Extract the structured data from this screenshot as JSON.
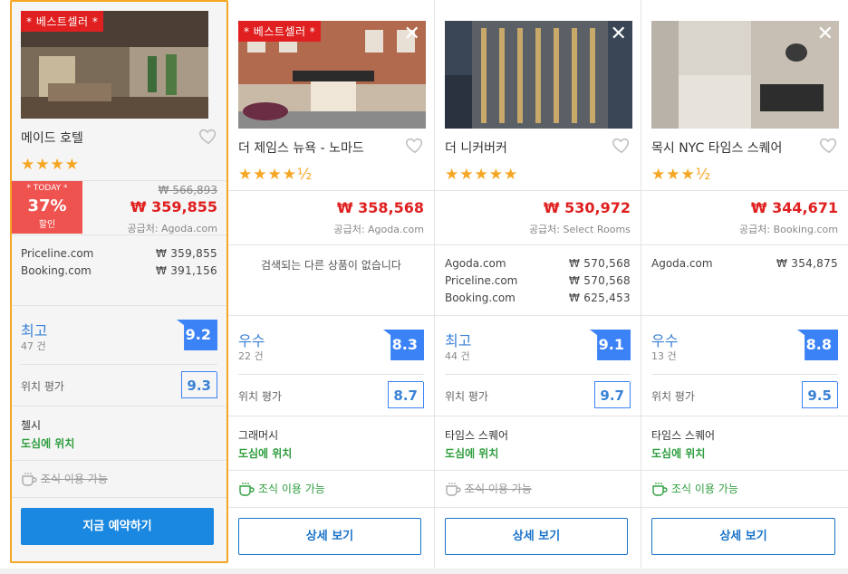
{
  "hotels": [
    {
      "badge": "* 베스트셀러 *",
      "name": "메이드 호텔",
      "stars": "★★★★",
      "today": {
        "label": "* TODAY *",
        "percent": "37%",
        "sub": "할인"
      },
      "old_price": "₩ 566,893",
      "price": "₩ 359,855",
      "supplier": "공급처: Agoda.com",
      "others": [
        {
          "site": "Priceline.com",
          "price": "₩ 359,855"
        },
        {
          "site": "Booking.com",
          "price": "₩ 391,156"
        }
      ],
      "rating_label": "최고",
      "rating_count": "47 건",
      "score": "9.2",
      "location_label": "위치 평가",
      "location_score": "9.3",
      "area": "첼시",
      "area_sub": "도심에 위치",
      "breakfast": "조식 이용 가능",
      "breakfast_available": false,
      "button": "지금 예약하기"
    },
    {
      "badge": "* 베스트셀러 *",
      "name": "더 제임스 뉴욕 - 노마드",
      "stars": "★★★★½",
      "price": "₩ 358,568",
      "supplier": "공급처: Agoda.com",
      "no_results": "검색되는 다른 상품이 없습니다",
      "rating_label": "우수",
      "rating_count": "22 건",
      "score": "8.3",
      "location_label": "위치 평가",
      "location_score": "8.7",
      "area": "그래머시",
      "area_sub": "도심에 위치",
      "breakfast": "조식 이용 가능",
      "breakfast_available": true,
      "button": "상세 보기"
    },
    {
      "name": "더 니커버커",
      "stars": "★★★★★",
      "price": "₩ 530,972",
      "supplier": "공급처: Select Rooms",
      "others": [
        {
          "site": "Agoda.com",
          "price": "₩ 570,568"
        },
        {
          "site": "Priceline.com",
          "price": "₩ 570,568"
        },
        {
          "site": "Booking.com",
          "price": "₩ 625,453"
        }
      ],
      "rating_label": "최고",
      "rating_count": "44 건",
      "score": "9.1",
      "location_label": "위치 평가",
      "location_score": "9.7",
      "area": "타임스 스퀘어",
      "area_sub": "도심에 위치",
      "breakfast": "조식 이용 가능",
      "breakfast_available": false,
      "button": "상세 보기"
    },
    {
      "name": "목시 NYC 타임스 스퀘어",
      "stars": "★★★½",
      "price": "₩ 344,671",
      "supplier": "공급처: Booking.com",
      "others": [
        {
          "site": "Agoda.com",
          "price": "₩ 354,875"
        }
      ],
      "rating_label": "우수",
      "rating_count": "13 건",
      "score": "8.8",
      "location_label": "위치 평가",
      "location_score": "9.5",
      "area": "타임스 스퀘어",
      "area_sub": "도심에 위치",
      "breakfast": "조식 이용 가능",
      "breakfast_available": true,
      "button": "상세 보기"
    }
  ],
  "colors": {
    "accent": "#f5a623",
    "price": "#e02020",
    "score": "#3b82f6",
    "green": "#2e9e3e",
    "primary_button": "#1a88e0"
  }
}
